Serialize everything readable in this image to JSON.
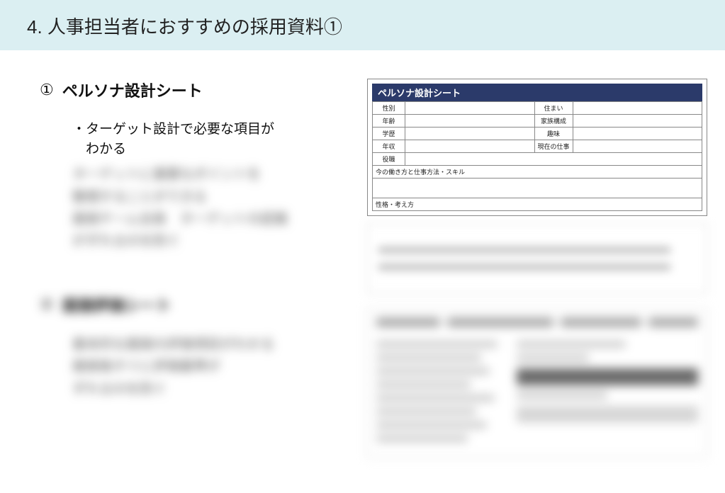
{
  "header": {
    "title": "4. 人事担当者におすすめの採用資料①"
  },
  "item1": {
    "number": "①",
    "title": "ペルソナ設計シート",
    "bullet1": "・ターゲット設計で必要な項目が\n　わかる"
  },
  "sheet": {
    "title": "ペルソナ設計シート",
    "rows": [
      {
        "l1": "性別",
        "l2": "住まい"
      },
      {
        "l1": "年齢",
        "l2": "家族構成"
      },
      {
        "l1": "学歴",
        "l2": "趣味"
      },
      {
        "l1": "年収",
        "l2": "現在の仕事"
      }
    ],
    "row5": "役職",
    "section1": "今の働き方と仕事方法・スキル",
    "section2": "性格・考え方"
  }
}
